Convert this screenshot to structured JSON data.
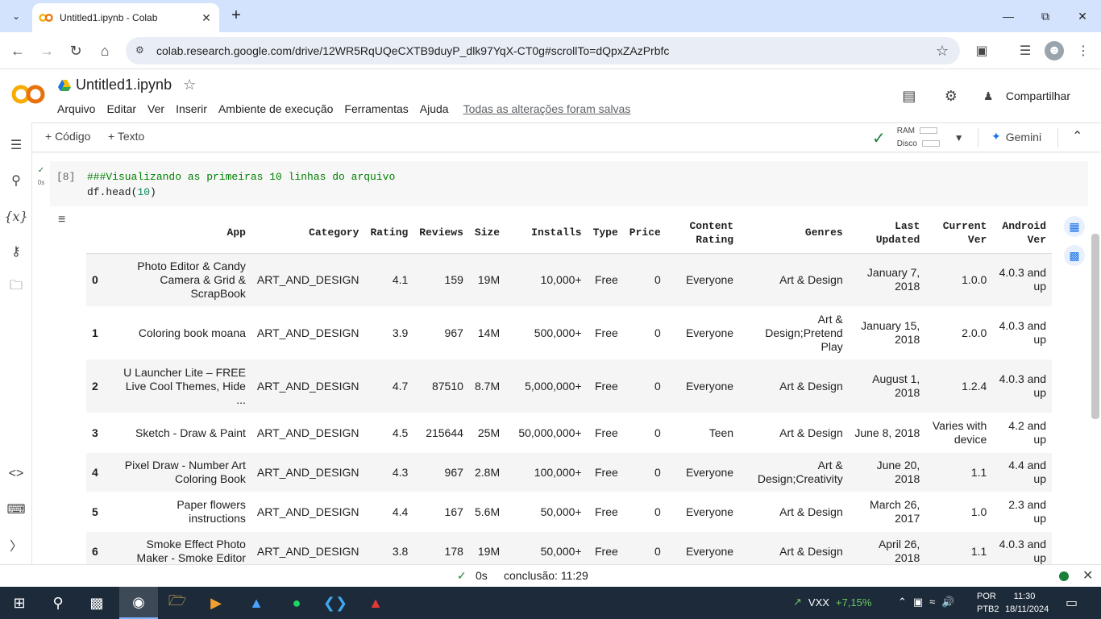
{
  "browser": {
    "tab_title": "Untitled1.ipynb - Colab",
    "url": "colab.research.google.com/drive/12WR5RqUQeCXTB9duyP_dlk97YqX-CT0g#scrollTo=dQpxZAzPrbfc"
  },
  "colab": {
    "notebook_name": "Untitled1.ipynb",
    "menu": [
      "Arquivo",
      "Editar",
      "Ver",
      "Inserir",
      "Ambiente de execução",
      "Ferramentas",
      "Ajuda"
    ],
    "saved_status": "Todas as alterações foram salvas",
    "share_label": "Compartilhar",
    "toolbar": {
      "code_label": "+ Código",
      "text_label": "+ Texto",
      "ram_label": "RAM",
      "disk_label": "Disco",
      "gemini_label": "Gemini"
    }
  },
  "cell": {
    "prompt": "[8]",
    "run_time": "0s",
    "code_comment": "###Visualizando as primeiras 10 linhas do arquivo",
    "code_call_prefix": "df.head(",
    "code_call_arg": "10",
    "code_call_suffix": ")"
  },
  "dataframe": {
    "columns": [
      "",
      "App",
      "Category",
      "Rating",
      "Reviews",
      "Size",
      "Installs",
      "Type",
      "Price",
      "Content Rating",
      "Genres",
      "Last Updated",
      "Current Ver",
      "Android Ver"
    ],
    "rows": [
      [
        "0",
        "Photo Editor & Candy Camera & Grid & ScrapBook",
        "ART_AND_DESIGN",
        "4.1",
        "159",
        "19M",
        "10,000+",
        "Free",
        "0",
        "Everyone",
        "Art & Design",
        "January 7, 2018",
        "1.0.0",
        "4.0.3 and up"
      ],
      [
        "1",
        "Coloring book moana",
        "ART_AND_DESIGN",
        "3.9",
        "967",
        "14M",
        "500,000+",
        "Free",
        "0",
        "Everyone",
        "Art & Design;Pretend Play",
        "January 15, 2018",
        "2.0.0",
        "4.0.3 and up"
      ],
      [
        "2",
        "U Launcher Lite – FREE Live Cool Themes, Hide ...",
        "ART_AND_DESIGN",
        "4.7",
        "87510",
        "8.7M",
        "5,000,000+",
        "Free",
        "0",
        "Everyone",
        "Art & Design",
        "August 1, 2018",
        "1.2.4",
        "4.0.3 and up"
      ],
      [
        "3",
        "Sketch - Draw & Paint",
        "ART_AND_DESIGN",
        "4.5",
        "215644",
        "25M",
        "50,000,000+",
        "Free",
        "0",
        "Teen",
        "Art & Design",
        "June 8, 2018",
        "Varies with device",
        "4.2 and up"
      ],
      [
        "4",
        "Pixel Draw - Number Art Coloring Book",
        "ART_AND_DESIGN",
        "4.3",
        "967",
        "2.8M",
        "100,000+",
        "Free",
        "0",
        "Everyone",
        "Art & Design;Creativity",
        "June 20, 2018",
        "1.1",
        "4.4 and up"
      ],
      [
        "5",
        "Paper flowers instructions",
        "ART_AND_DESIGN",
        "4.4",
        "167",
        "5.6M",
        "50,000+",
        "Free",
        "0",
        "Everyone",
        "Art & Design",
        "March 26, 2017",
        "1.0",
        "2.3 and up"
      ],
      [
        "6",
        "Smoke Effect Photo Maker - Smoke Editor",
        "ART_AND_DESIGN",
        "3.8",
        "178",
        "19M",
        "50,000+",
        "Free",
        "0",
        "Everyone",
        "Art & Design",
        "April 26, 2018",
        "1.1",
        "4.0.3 and up"
      ]
    ]
  },
  "status": {
    "elapsed": "0s",
    "completion": "conclusão: 11:29"
  },
  "taskbar": {
    "stock_name": "VXX",
    "stock_change": "+7,15%",
    "lang_line1": "POR",
    "lang_line2": "PTB2",
    "time": "11:30",
    "date": "18/11/2024"
  }
}
